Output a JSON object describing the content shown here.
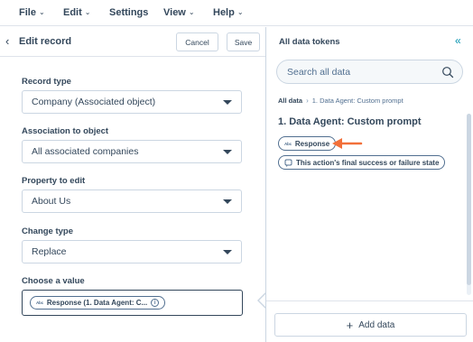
{
  "menu": {
    "file": "File",
    "edit": "Edit",
    "settings": "Settings",
    "view": "View",
    "help": "Help"
  },
  "editor": {
    "title": "Edit record",
    "cancel_label": "Cancel",
    "save_label": "Save"
  },
  "form": {
    "record_type": {
      "label": "Record type",
      "value": "Company (Associated object)"
    },
    "association": {
      "label": "Association to object",
      "value": "All associated companies"
    },
    "property": {
      "label": "Property to edit",
      "value": "About Us"
    },
    "change_type": {
      "label": "Change type",
      "value": "Replace"
    },
    "choose_value": {
      "label": "Choose a value",
      "token_badge": "Abc",
      "token_text": "Response (1. Data Agent: C..."
    }
  },
  "tokens_panel": {
    "title": "All data tokens",
    "search_placeholder": "Search all data",
    "breadcrumb_root": "All data",
    "breadcrumb_separator": "›",
    "breadcrumb_current": "1. Data Agent: Custom prompt",
    "section_title": "1. Data Agent: Custom prompt",
    "tokens": [
      {
        "badge": "Abc",
        "label": "Response"
      },
      {
        "label": "This action's final success or failure state"
      }
    ],
    "add_data_label": "Add data"
  },
  "colors": {
    "text": "#33475b",
    "border": "#cbd6e2",
    "accent": "#0091ae",
    "annotation_arrow": "#f2703a"
  },
  "icons": {
    "back": "chevron-left-icon",
    "collapse": "double-chevron-left-icon",
    "search": "search-icon",
    "info": "info-icon",
    "plus": "plus-icon",
    "status": "status-icon",
    "annotation": "arrow-left-icon"
  }
}
